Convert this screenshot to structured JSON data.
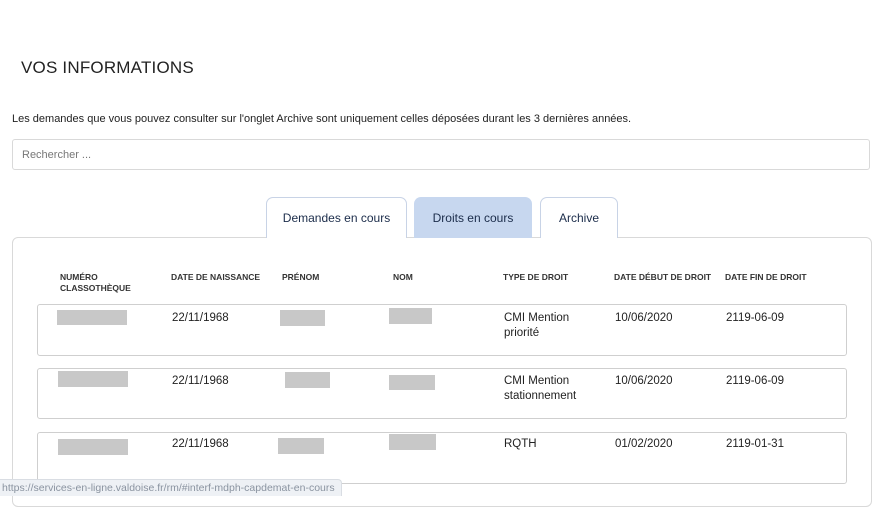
{
  "page": {
    "title": "VOS INFORMATIONS",
    "notice": "Les demandes que vous pouvez consulter sur l'onglet Archive sont uniquement celles déposées durant les 3 dernières années."
  },
  "search": {
    "placeholder": "Rechercher ..."
  },
  "tabs": [
    {
      "label": "Demandes en cours",
      "active": false
    },
    {
      "label": "Droits en cours",
      "active": true
    },
    {
      "label": "Archive",
      "active": false
    }
  ],
  "table": {
    "columns": [
      "NUMÉRO CLASSOTHÈQUE",
      "DATE DE NAISSANCE",
      "PRÉNOM",
      "NOM",
      "TYPE DE DROIT",
      "DATE DÉBUT DE DROIT",
      "DATE FIN DE DROIT"
    ],
    "rows": [
      {
        "date_naissance": "22/11/1968",
        "type_droit": "CMI Mention priorité",
        "date_debut": "10/06/2020",
        "date_fin": "2119-06-09"
      },
      {
        "date_naissance": "22/11/1968",
        "type_droit": "CMI Mention stationnement",
        "date_debut": "10/06/2020",
        "date_fin": "2119-06-09"
      },
      {
        "date_naissance": "22/11/1968",
        "type_droit": "RQTH",
        "date_debut": "01/02/2020",
        "date_fin": "2119-01-31"
      }
    ]
  },
  "status_bar": {
    "url": "https://services-en-ligne.valdoise.fr/rm/#interf-mdph-capdemat-en-cours"
  },
  "colors": {
    "active_tab_bg": "#c7d7ef",
    "tab_text": "#1b2c4a",
    "redaction": "#c8c8c8"
  }
}
